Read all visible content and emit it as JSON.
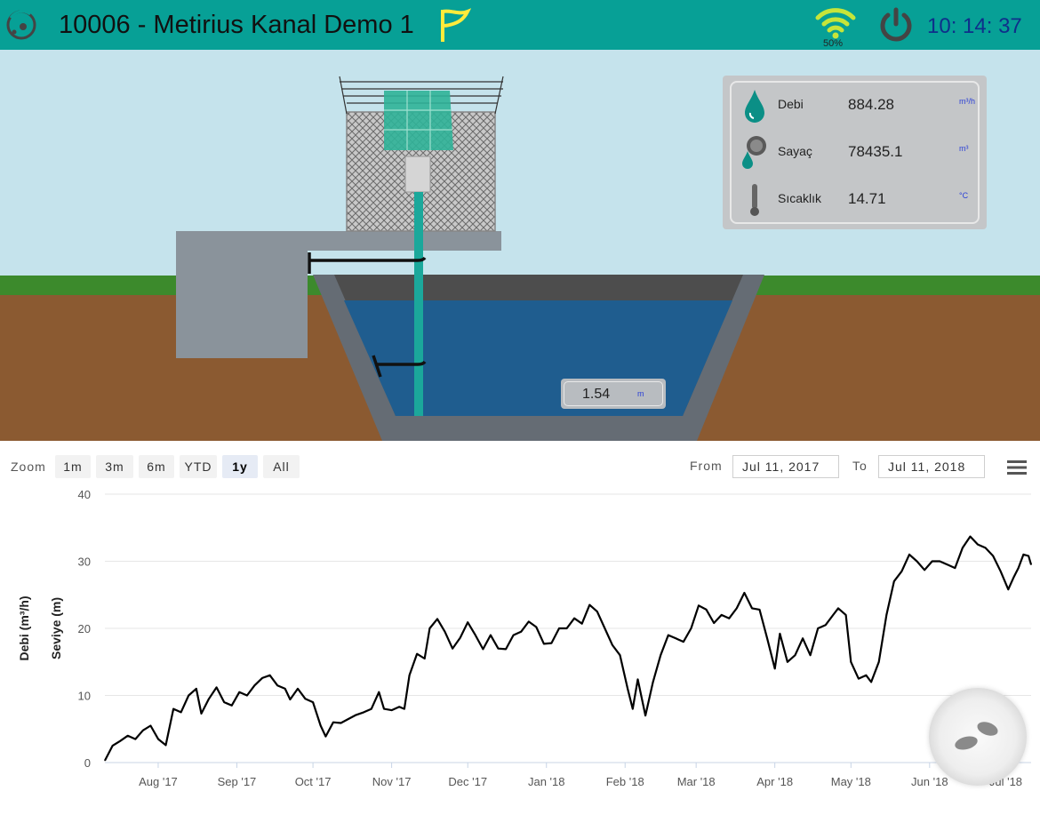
{
  "header": {
    "title": "10006 - Metirius Kanal Demo 1",
    "wifi_percent": "50%",
    "clock": "10: 14: 37",
    "bar_color": "#07a096"
  },
  "info_panel": {
    "rows": [
      {
        "label": "Debi",
        "value": "884.28",
        "unit": "m³/h",
        "icon": "water-drop-icon"
      },
      {
        "label": "Sayaç",
        "value": "78435.1",
        "unit": "m³",
        "icon": "meter-icon"
      },
      {
        "label": "Sıcaklık",
        "value": "14.71",
        "unit": "°C",
        "icon": "thermometer-icon"
      }
    ]
  },
  "level": {
    "value": "1.54",
    "unit": "m"
  },
  "toolbar": {
    "zoom_label": "Zoom",
    "zoom_buttons": [
      "1m",
      "3m",
      "6m",
      "YTD",
      "1y",
      "All"
    ],
    "active_zoom": "1y",
    "from_label": "From",
    "from_value": "Jul 11, 2017",
    "to_label": "To",
    "to_value": "Jul 11, 2018"
  },
  "chart_data": {
    "type": "line",
    "ylabel_left": "Debi (m³/h)",
    "ylabel_right": "Seviye (m)",
    "ylim": [
      0,
      40
    ],
    "yticks": [
      0,
      10,
      20,
      30,
      40
    ],
    "grid": true,
    "xlabels": [
      "Aug '17",
      "Sep '17",
      "Oct '17",
      "Nov '17",
      "Dec '17",
      "Jan '18",
      "Feb '18",
      "Mar '18",
      "Apr '18",
      "May '18",
      "Jun '18",
      "Jul '18"
    ],
    "series": [
      {
        "color": "#000000",
        "points": [
          [
            "2017-07-11",
            0.3
          ],
          [
            "2017-07-14",
            2.5
          ],
          [
            "2017-07-17",
            3.2
          ],
          [
            "2017-07-20",
            4.0
          ],
          [
            "2017-07-23",
            3.5
          ],
          [
            "2017-07-26",
            4.8
          ],
          [
            "2017-07-29",
            5.5
          ],
          [
            "2017-08-01",
            3.5
          ],
          [
            "2017-08-04",
            2.6
          ],
          [
            "2017-08-07",
            8.0
          ],
          [
            "2017-08-10",
            7.5
          ],
          [
            "2017-08-13",
            10.0
          ],
          [
            "2017-08-16",
            11.0
          ],
          [
            "2017-08-18",
            7.3
          ],
          [
            "2017-08-21",
            9.5
          ],
          [
            "2017-08-24",
            11.2
          ],
          [
            "2017-08-27",
            9.0
          ],
          [
            "2017-08-30",
            8.5
          ],
          [
            "2017-09-02",
            10.5
          ],
          [
            "2017-09-05",
            10.0
          ],
          [
            "2017-09-08",
            11.5
          ],
          [
            "2017-09-11",
            12.6
          ],
          [
            "2017-09-14",
            13.0
          ],
          [
            "2017-09-17",
            11.5
          ],
          [
            "2017-09-20",
            11.0
          ],
          [
            "2017-09-22",
            9.4
          ],
          [
            "2017-09-25",
            11.0
          ],
          [
            "2017-09-28",
            9.5
          ],
          [
            "2017-10-01",
            9.0
          ],
          [
            "2017-10-04",
            5.5
          ],
          [
            "2017-10-06",
            3.9
          ],
          [
            "2017-10-09",
            6.0
          ],
          [
            "2017-10-12",
            5.9
          ],
          [
            "2017-10-15",
            6.5
          ],
          [
            "2017-10-18",
            7.1
          ],
          [
            "2017-10-21",
            7.5
          ],
          [
            "2017-10-24",
            8.0
          ],
          [
            "2017-10-27",
            10.5
          ],
          [
            "2017-10-29",
            8.0
          ],
          [
            "2017-11-01",
            7.8
          ],
          [
            "2017-11-04",
            8.3
          ],
          [
            "2017-11-06",
            8.0
          ],
          [
            "2017-11-08",
            13.0
          ],
          [
            "2017-11-11",
            16.2
          ],
          [
            "2017-11-14",
            15.5
          ],
          [
            "2017-11-16",
            20.0
          ],
          [
            "2017-11-19",
            21.4
          ],
          [
            "2017-11-22",
            19.5
          ],
          [
            "2017-11-25",
            17.0
          ],
          [
            "2017-11-28",
            18.6
          ],
          [
            "2017-12-01",
            20.9
          ],
          [
            "2017-12-04",
            19.0
          ],
          [
            "2017-12-07",
            16.9
          ],
          [
            "2017-12-10",
            19.0
          ],
          [
            "2017-12-13",
            17.0
          ],
          [
            "2017-12-16",
            16.9
          ],
          [
            "2017-12-19",
            19.0
          ],
          [
            "2017-12-22",
            19.5
          ],
          [
            "2017-12-25",
            21.0
          ],
          [
            "2017-12-28",
            20.2
          ],
          [
            "2017-12-31",
            17.7
          ],
          [
            "2018-01-03",
            17.8
          ],
          [
            "2018-01-06",
            20.0
          ],
          [
            "2018-01-09",
            20.0
          ],
          [
            "2018-01-12",
            21.5
          ],
          [
            "2018-01-15",
            20.7
          ],
          [
            "2018-01-18",
            23.5
          ],
          [
            "2018-01-21",
            22.5
          ],
          [
            "2018-01-24",
            20.0
          ],
          [
            "2018-01-27",
            17.5
          ],
          [
            "2018-01-30",
            16.0
          ],
          [
            "2018-02-02",
            11.0
          ],
          [
            "2018-02-04",
            8.0
          ],
          [
            "2018-02-06",
            12.4
          ],
          [
            "2018-02-09",
            7.0
          ],
          [
            "2018-02-12",
            12.0
          ],
          [
            "2018-02-15",
            16.0
          ],
          [
            "2018-02-18",
            19.0
          ],
          [
            "2018-02-21",
            18.5
          ],
          [
            "2018-02-24",
            18.0
          ],
          [
            "2018-02-27",
            20.0
          ],
          [
            "2018-03-02",
            23.4
          ],
          [
            "2018-03-05",
            22.8
          ],
          [
            "2018-03-08",
            20.8
          ],
          [
            "2018-03-11",
            22.0
          ],
          [
            "2018-03-14",
            21.5
          ],
          [
            "2018-03-17",
            23.0
          ],
          [
            "2018-03-20",
            25.3
          ],
          [
            "2018-03-23",
            23.0
          ],
          [
            "2018-03-26",
            22.8
          ],
          [
            "2018-03-29",
            18.5
          ],
          [
            "2018-04-01",
            14.0
          ],
          [
            "2018-04-03",
            19.2
          ],
          [
            "2018-04-06",
            15.0
          ],
          [
            "2018-04-09",
            16.0
          ],
          [
            "2018-04-12",
            18.5
          ],
          [
            "2018-04-15",
            16.0
          ],
          [
            "2018-04-18",
            20.0
          ],
          [
            "2018-04-21",
            20.5
          ],
          [
            "2018-04-24",
            22.0
          ],
          [
            "2018-04-26",
            23.0
          ],
          [
            "2018-04-29",
            22.0
          ],
          [
            "2018-05-01",
            15.0
          ],
          [
            "2018-05-04",
            12.5
          ],
          [
            "2018-05-07",
            13.0
          ],
          [
            "2018-05-09",
            12.0
          ],
          [
            "2018-05-12",
            15.0
          ],
          [
            "2018-05-15",
            22.0
          ],
          [
            "2018-05-18",
            27.0
          ],
          [
            "2018-05-21",
            28.5
          ],
          [
            "2018-05-24",
            31.0
          ],
          [
            "2018-05-27",
            30.0
          ],
          [
            "2018-05-30",
            28.7
          ],
          [
            "2018-06-02",
            30.0
          ],
          [
            "2018-06-05",
            30.0
          ],
          [
            "2018-06-08",
            29.5
          ],
          [
            "2018-06-11",
            29.0
          ],
          [
            "2018-06-14",
            32.0
          ],
          [
            "2018-06-17",
            33.7
          ],
          [
            "2018-06-20",
            32.5
          ],
          [
            "2018-06-23",
            32.0
          ],
          [
            "2018-06-26",
            30.8
          ],
          [
            "2018-06-29",
            28.5
          ],
          [
            "2018-07-02",
            25.8
          ],
          [
            "2018-07-04",
            27.5
          ],
          [
            "2018-07-06",
            29.0
          ],
          [
            "2018-07-08",
            31.0
          ],
          [
            "2018-07-10",
            30.8
          ],
          [
            "2018-07-11",
            29.5
          ]
        ]
      }
    ]
  }
}
